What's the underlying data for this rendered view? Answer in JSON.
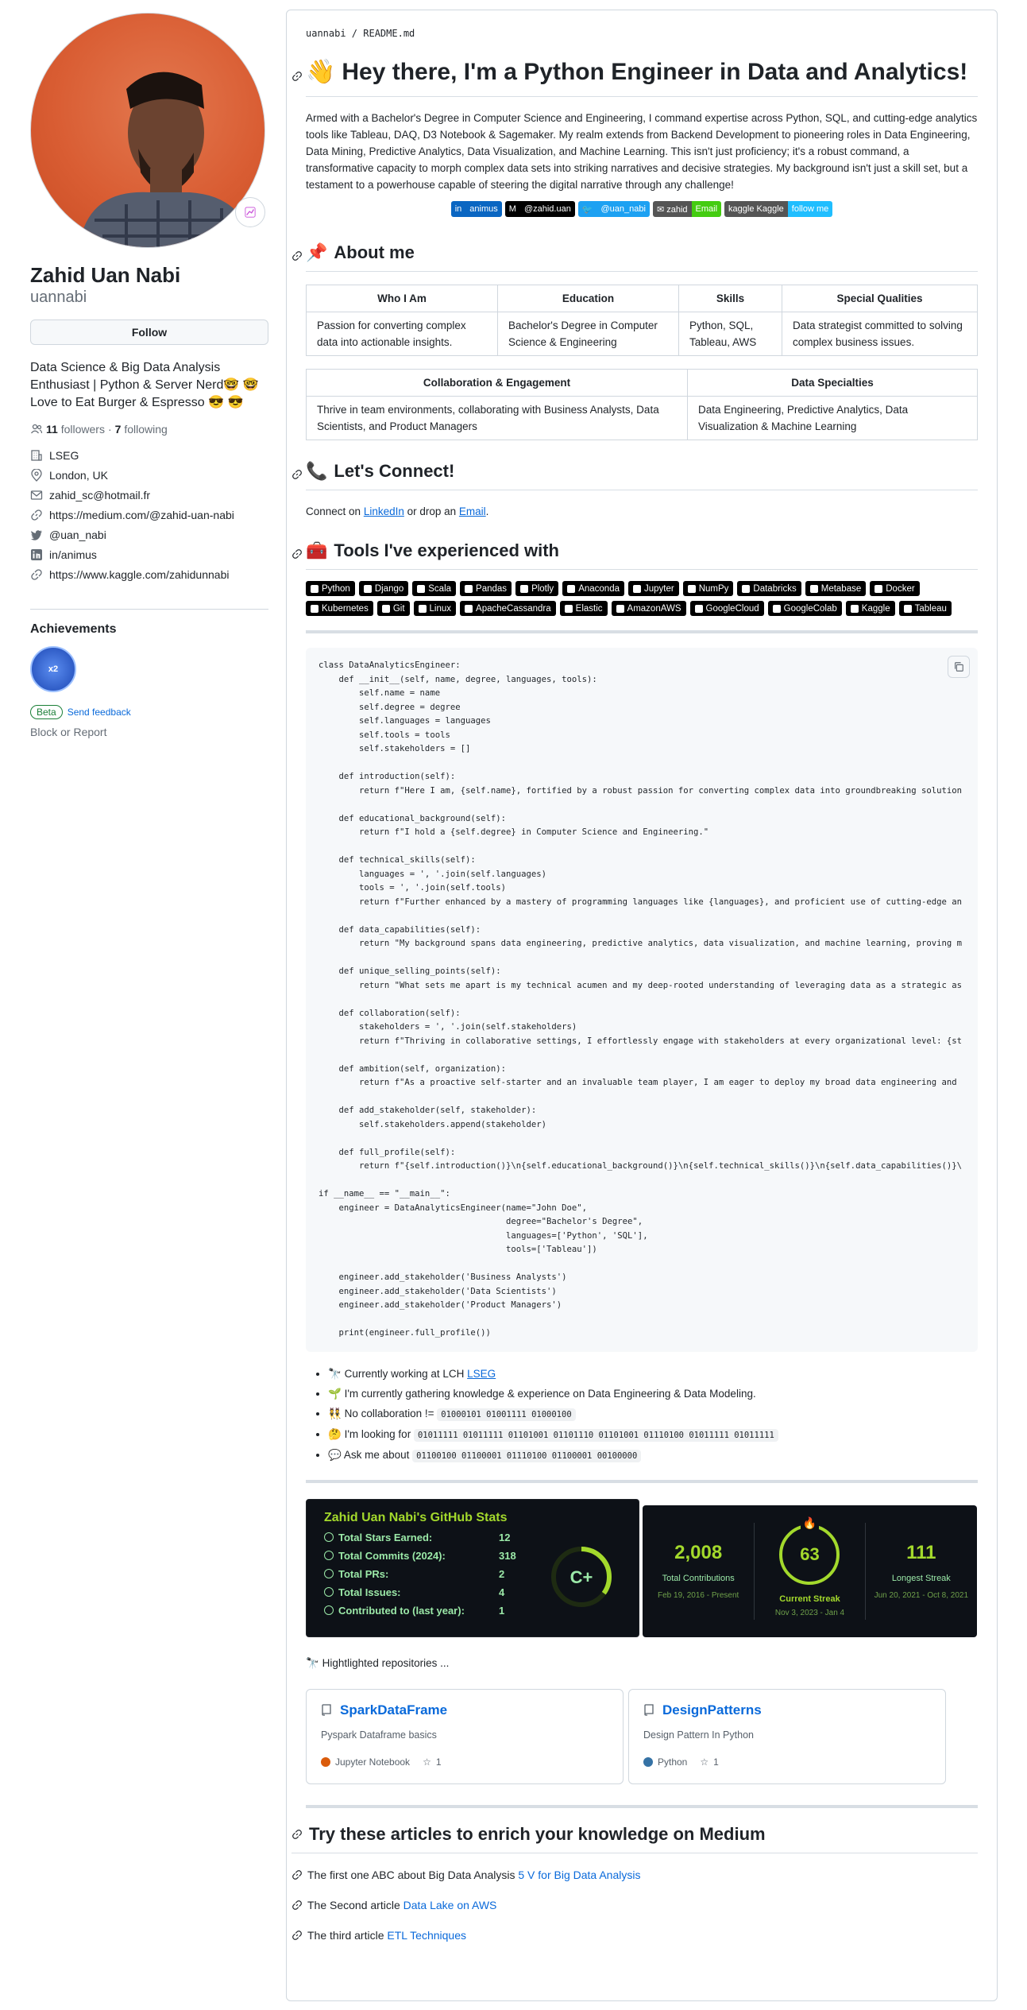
{
  "profile": {
    "full_name": "Zahid Uan Nabi",
    "login": "uannabi",
    "follow_label": "Follow",
    "bio": "Data Science & Big Data Analysis Enthusiast | Python & Server Nerd🤓 🤓 Love to Eat Burger & Espresso 😎 😎",
    "followers_count": "11",
    "followers_label": "followers",
    "separator": "·",
    "following_count": "7",
    "following_label": "following",
    "company": "LSEG",
    "location": "London, UK",
    "email": "zahid_sc@hotmail.fr",
    "website": "https://medium.com/@zahid-uan-nabi",
    "twitter": "@uan_nabi",
    "linkedin": "in/animus",
    "kaggle": "https://www.kaggle.com/zahidunnabi",
    "achievements_title": "Achievements",
    "achievement_badge": "x2",
    "beta_label": "Beta",
    "feedback_label": "Send feedback",
    "block_label": "Block or Report"
  },
  "readme": {
    "breadcrumb": "uannabi / README.md",
    "title_emoji": "👋",
    "title": "Hey there, I'm a Python Engineer in Data and Analytics!",
    "intro": "Armed with a Bachelor's Degree in Computer Science and Engineering, I command expertise across Python, SQL, and cutting-edge analytics tools like Tableau, DAQ, D3 Notebook & Sagemaker. My realm extends from Backend Development to pioneering roles in Data Engineering, Data Mining, Predictive Analytics, Data Visualization, and Machine Learning. This isn't just proficiency; it's a robust command, a transformative capacity to morph complex data sets into striking narratives and decisive strategies. My background isn't just a skill set, but a testament to a powerhouse capable of steering the digital narrative through any challenge!",
    "shields": [
      {
        "l": "in",
        "r": "animus",
        "lc": "#0a66c2",
        "rc": "#0a66c2"
      },
      {
        "l": "M",
        "r": "@zahid.uan",
        "lc": "#000",
        "rc": "#000"
      },
      {
        "l": "🐦",
        "r": "@uan_nabi",
        "lc": "#1da1f2",
        "rc": "#1da1f2"
      },
      {
        "l": "✉ zahid",
        "r": "Email",
        "lc": "#555",
        "rc": "#4c1"
      },
      {
        "l": "kaggle Kaggle",
        "r": "follow me",
        "lc": "#555",
        "rc": "#20beff"
      }
    ],
    "about_emoji": "📌",
    "about_title": "About me",
    "table1": {
      "headers": [
        "Who I Am",
        "Education",
        "Skills",
        "Special Qualities"
      ],
      "row": [
        "Passion for converting complex data into actionable insights.",
        "Bachelor's Degree in Computer Science & Engineering",
        "Python, SQL, Tableau, AWS",
        "Data strategist committed to solving complex business issues."
      ]
    },
    "table2": {
      "headers": [
        "Collaboration & Engagement",
        "Data Specialties"
      ],
      "row": [
        "Thrive in team environments, collaborating with Business Analysts, Data Scientists, and Product Managers",
        "Data Engineering, Predictive Analytics, Data Visualization & Machine Learning"
      ]
    },
    "connect_emoji": "📞",
    "connect_title": "Let's Connect!",
    "connect_pre": "Connect on ",
    "connect_linkedin": "LinkedIn",
    "connect_mid": " or drop an ",
    "connect_email": "Email",
    "connect_end": ".",
    "tools_emoji": "🧰",
    "tools_title": "Tools I've experienced with",
    "tools": [
      "Python",
      "Django",
      "Scala",
      "Pandas",
      "Plotly",
      "Anaconda",
      "Jupyter",
      "NumPy",
      "Databricks",
      "Metabase",
      "Docker",
      "Kubernetes",
      "Git",
      "Linux",
      "ApacheCassandra",
      "Elastic",
      "AmazonAWS",
      "GoogleCloud",
      "GoogleColab",
      "Kaggle",
      "Tableau"
    ],
    "code": "class DataAnalyticsEngineer:\n    def __init__(self, name, degree, languages, tools):\n        self.name = name\n        self.degree = degree\n        self.languages = languages\n        self.tools = tools\n        self.stakeholders = []\n\n    def introduction(self):\n        return f\"Here I am, {self.name}, fortified by a robust passion for converting complex data into groundbreaking solution\n\n    def educational_background(self):\n        return f\"I hold a {self.degree} in Computer Science and Engineering.\"\n\n    def technical_skills(self):\n        languages = ', '.join(self.languages)\n        tools = ', '.join(self.tools)\n        return f\"Further enhanced by a mastery of programming languages like {languages}, and proficient use of cutting-edge an\n\n    def data_capabilities(self):\n        return \"My background spans data engineering, predictive analytics, data visualization, and machine learning, proving m\n\n    def unique_selling_points(self):\n        return \"What sets me apart is my technical acumen and my deep-rooted understanding of leveraging data as a strategic as\n\n    def collaboration(self):\n        stakeholders = ', '.join(self.stakeholders)\n        return f\"Thriving in collaborative settings, I effortlessly engage with stakeholders at every organizational level: {st\n\n    def ambition(self, organization):\n        return f\"As a proactive self-starter and an invaluable team player, I am eager to deploy my broad data engineering and\n\n    def add_stakeholder(self, stakeholder):\n        self.stakeholders.append(stakeholder)\n\n    def full_profile(self):\n        return f\"{self.introduction()}\\n{self.educational_background()}\\n{self.technical_skills()}\\n{self.data_capabilities()}\\\n\nif __name__ == \"__main__\":\n    engineer = DataAnalyticsEngineer(name=\"John Doe\",\n                                     degree=\"Bachelor's Degree\",\n                                     languages=['Python', 'SQL'],\n                                     tools=['Tableau'])\n\n    engineer.add_stakeholder('Business Analysts')\n    engineer.add_stakeholder('Data Scientists')\n    engineer.add_stakeholder('Product Managers')\n\n    print(engineer.full_profile())",
    "bullets": [
      {
        "emoji": "🔭",
        "text": "Currently working at LCH ",
        "link": "LSEG",
        "code": ""
      },
      {
        "emoji": "🌱",
        "text": "I'm currently gathering knowledge & experience on Data Engineering & Data Modeling.",
        "link": "",
        "code": ""
      },
      {
        "emoji": "👯",
        "text": "No collaboration != ",
        "link": "",
        "code": "01000101 01001111 01000100"
      },
      {
        "emoji": "🤔",
        "text": "I'm looking for ",
        "link": "",
        "code": "01011111 01011111 01101001 01101110 01101001 01110100 01011111 01011111"
      },
      {
        "emoji": "💬",
        "text": "Ask me about ",
        "link": "",
        "code": "01100100 01100001 01110100 01100001 00100000"
      }
    ],
    "stats": {
      "title": "Zahid Uan Nabi's GitHub Stats",
      "rows": [
        {
          "label": "Total Stars Earned:",
          "value": "12"
        },
        {
          "label": "Total Commits (2024):",
          "value": "318"
        },
        {
          "label": "Total PRs:",
          "value": "2"
        },
        {
          "label": "Total Issues:",
          "value": "4"
        },
        {
          "label": "Contributed to (last year):",
          "value": "1"
        }
      ],
      "grade": "C+",
      "grade_progress": 0.35
    },
    "streak": {
      "total": "2,008",
      "total_label": "Total Contributions",
      "total_dates": "Feb 19, 2016 - Present",
      "current": "63",
      "current_label": "Current Streak",
      "current_dates": "Nov 3, 2023 - Jan 4",
      "longest": "111",
      "longest_label": "Longest Streak",
      "longest_dates": "Jun 20, 2021 - Oct 8, 2021"
    },
    "repos_emoji": "🔭",
    "repos_title": "Hightlighted repositories ...",
    "repos": [
      {
        "name": "SparkDataFrame",
        "desc": "Pyspark Dataframe basics",
        "lang": "Jupyter Notebook",
        "lang_color": "#DA5B0B",
        "stars": "1"
      },
      {
        "name": "DesignPatterns",
        "desc": "Design Pattern In Python",
        "lang": "Python",
        "lang_color": "#3572A5",
        "stars": "1"
      }
    ],
    "articles_title": "Try these articles to enrich your knowledge on Medium",
    "articles": [
      {
        "text": "The first one ABC about Big Data Analysis ",
        "link": "5 V for Big Data Analysis"
      },
      {
        "text": "The Second article ",
        "link": "Data Lake on AWS"
      },
      {
        "text": "The third article ",
        "link": "ETL Techniques"
      }
    ]
  }
}
